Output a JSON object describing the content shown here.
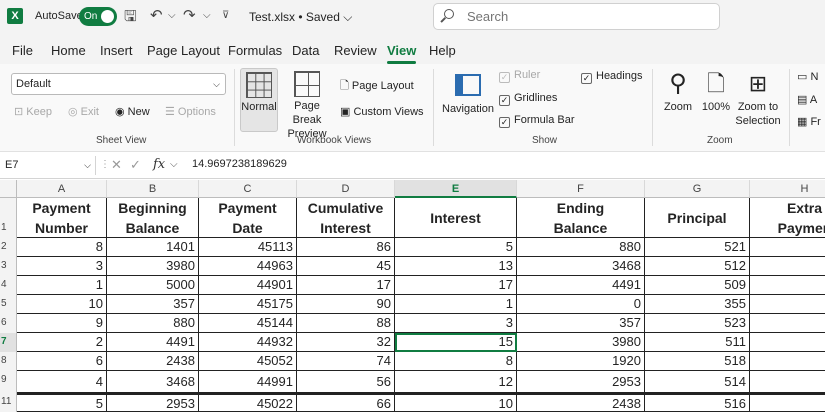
{
  "titlebar": {
    "autosave_label": "AutoSave",
    "autosave_state": "On",
    "doc_title": "Test.xlsx • Saved ⌵",
    "search_placeholder": "Search"
  },
  "menu": [
    "File",
    "Home",
    "Insert",
    "Page Layout",
    "Formulas",
    "Data",
    "Review",
    "View",
    "Help"
  ],
  "active_tab": "View",
  "ribbon": {
    "sheet_view": {
      "select_value": "Default",
      "keep": "Keep",
      "exit": "Exit",
      "new": "New",
      "options": "Options",
      "label": "Sheet View"
    },
    "workbook_views": {
      "normal": "Normal",
      "page_break_1": "Page Break",
      "page_break_2": "Preview",
      "page_layout": "Page Layout",
      "custom_views": "Custom Views",
      "label": "Workbook Views"
    },
    "show": {
      "navigation": "Navigation",
      "ruler": "Ruler",
      "gridlines": "Gridlines",
      "formula_bar": "Formula Bar",
      "headings": "Headings",
      "label": "Show"
    },
    "zoom": {
      "zoom": "Zoom",
      "hundred": "100%",
      "zoom_sel_1": "Zoom to",
      "zoom_sel_2": "Selection",
      "label": "Zoom"
    },
    "window": {
      "new": "N",
      "arrange": "A",
      "freeze": "Fr"
    }
  },
  "formula_bar": {
    "name_box": "E7",
    "value": "14.9697238189629"
  },
  "columns": [
    "A",
    "B",
    "C",
    "D",
    "E",
    "F",
    "G",
    "H"
  ],
  "rows": [
    "1",
    "2",
    "3",
    "4",
    "5",
    "6",
    "7",
    "8",
    "9",
    "11"
  ],
  "header_row": [
    [
      "Payment",
      "Number"
    ],
    [
      "Beginning",
      "Balance"
    ],
    [
      "Payment",
      "Date"
    ],
    [
      "Cumulative",
      "Interest"
    ],
    [
      "Interest",
      ""
    ],
    [
      "Ending",
      "Balance"
    ],
    [
      "Principal",
      ""
    ],
    [
      "Extra",
      "Paymen"
    ]
  ],
  "data_rows": [
    [
      "8",
      "1401",
      "45113",
      "86",
      "5",
      "880",
      "521",
      ""
    ],
    [
      "3",
      "3980",
      "44963",
      "45",
      "13",
      "3468",
      "512",
      ""
    ],
    [
      "1",
      "5000",
      "44901",
      "17",
      "17",
      "4491",
      "509",
      ""
    ],
    [
      "10",
      "357",
      "45175",
      "90",
      "1",
      "0",
      "355",
      ""
    ],
    [
      "9",
      "880",
      "45144",
      "88",
      "3",
      "357",
      "523",
      ""
    ],
    [
      "2",
      "4491",
      "44932",
      "32",
      "15",
      "3980",
      "511",
      ""
    ],
    [
      "6",
      "2438",
      "45052",
      "74",
      "8",
      "1920",
      "518",
      ""
    ],
    [
      "4",
      "3468",
      "44991",
      "56",
      "12",
      "2953",
      "514",
      ""
    ],
    [
      "5",
      "2953",
      "45022",
      "66",
      "10",
      "2438",
      "516",
      ""
    ]
  ]
}
